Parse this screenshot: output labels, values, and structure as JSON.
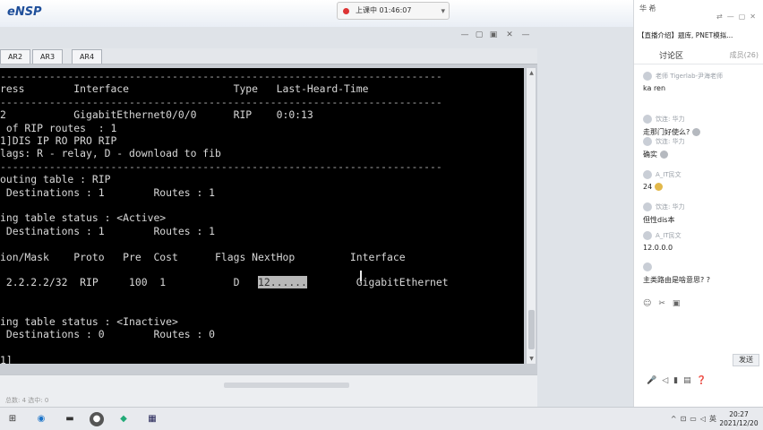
{
  "titlebar": {
    "app_name": "eNSP",
    "live_status": "上课中 01:46:07"
  },
  "tabs": [
    "AR2",
    "AR3",
    "AR4"
  ],
  "terminal": {
    "lines": [
      {
        "text": "------------------------------------------------------------------------",
        "kind": "dash"
      },
      {
        "text": "ress        Interface                 Type   Last-Heard-Time",
        "kind": "normal"
      },
      {
        "text": "------------------------------------------------------------------------",
        "kind": "dash"
      },
      {
        "text": "2           GigabitEthernet0/0/0      RIP    0:0:13",
        "kind": "normal"
      },
      {
        "text": " of RIP routes  : 1",
        "kind": "normal"
      },
      {
        "text": "1]DIS IP RO PRO RIP",
        "kind": "normal"
      },
      {
        "text": "lags: R - relay, D - download to fib",
        "kind": "normal"
      },
      {
        "text": "------------------------------------------------------------------------",
        "kind": "dash"
      },
      {
        "text": "outing table : RIP",
        "kind": "normal"
      },
      {
        "text": " Destinations : 1        Routes : 1",
        "kind": "normal"
      },
      {
        "text": "",
        "kind": "normal"
      },
      {
        "text": "ing table status : <Active>",
        "kind": "normal"
      },
      {
        "text": " Destinations : 1        Routes : 1",
        "kind": "normal"
      },
      {
        "text": "",
        "kind": "normal"
      },
      {
        "text": "ion/Mask    Proto   Pre  Cost      Flags NextHop         Interface",
        "kind": "normal"
      },
      {
        "text": "",
        "kind": "normal"
      },
      {
        "text": "",
        "kind": "normal"
      },
      {
        "text": "",
        "kind": "normal"
      },
      {
        "text": "",
        "kind": "normal"
      },
      {
        "text": "ing table status : <Inactive>",
        "kind": "normal"
      },
      {
        "text": " Destinations : 0        Routes : 0",
        "kind": "normal"
      },
      {
        "text": "",
        "kind": "normal"
      },
      {
        "text": "1]",
        "kind": "normal"
      }
    ],
    "route_prefix": " 2.2.2.2/32  RIP     100  1           D   ",
    "route_nexthop": "12......",
    "route_suffix": "        GigabitEthernet"
  },
  "status": {
    "total_label": "总数: 4 选中: 0"
  },
  "chat": {
    "user": "华 希",
    "course_title": "【直播介绍】题库, PNET模拟...",
    "tab_discuss": "讨论区",
    "tab_members": "成员(26)",
    "messages": [
      {
        "sender": "老师 Tigerlab-尹海老师",
        "text": "ka ren",
        "emoji": false
      },
      {
        "sender": "饮连: 华力",
        "text": "走那门好使么?",
        "emoji": true
      },
      {
        "sender": "饮连: 华力",
        "text": "确实",
        "emoji": true
      },
      {
        "sender": "A_IT民文",
        "text": "24",
        "emoji": true
      },
      {
        "sender": "饮连: 华力",
        "text": "但性dis本",
        "emoji": false
      },
      {
        "sender": "A_IT民文",
        "text": "12.0.0.0",
        "emoji": false
      },
      {
        "sender": "",
        "text": "主类路由是啥意思? ?",
        "emoji": false
      }
    ],
    "send_label": "发送"
  },
  "taskbar": {
    "ime": "英",
    "time": "20:27",
    "date": "2021/12/20"
  }
}
